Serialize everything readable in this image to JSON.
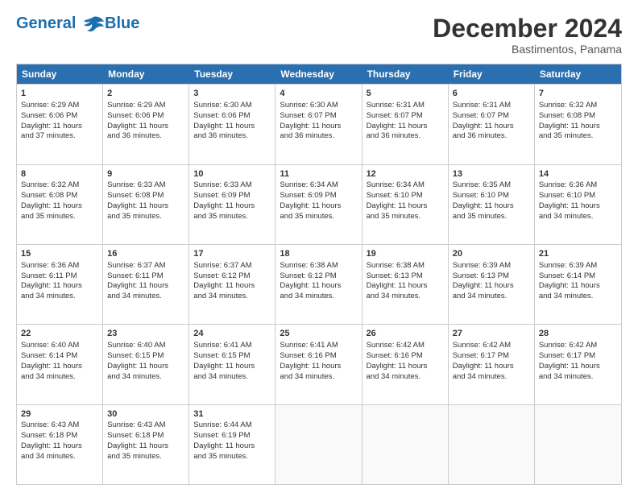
{
  "logo": {
    "line1": "General",
    "line2": "Blue"
  },
  "title": "December 2024",
  "subtitle": "Bastimentos, Panama",
  "days_of_week": [
    "Sunday",
    "Monday",
    "Tuesday",
    "Wednesday",
    "Thursday",
    "Friday",
    "Saturday"
  ],
  "weeks": [
    [
      {
        "day": "1",
        "info": "Sunrise: 6:29 AM\nSunset: 6:06 PM\nDaylight: 11 hours\nand 37 minutes."
      },
      {
        "day": "2",
        "info": "Sunrise: 6:29 AM\nSunset: 6:06 PM\nDaylight: 11 hours\nand 36 minutes."
      },
      {
        "day": "3",
        "info": "Sunrise: 6:30 AM\nSunset: 6:06 PM\nDaylight: 11 hours\nand 36 minutes."
      },
      {
        "day": "4",
        "info": "Sunrise: 6:30 AM\nSunset: 6:07 PM\nDaylight: 11 hours\nand 36 minutes."
      },
      {
        "day": "5",
        "info": "Sunrise: 6:31 AM\nSunset: 6:07 PM\nDaylight: 11 hours\nand 36 minutes."
      },
      {
        "day": "6",
        "info": "Sunrise: 6:31 AM\nSunset: 6:07 PM\nDaylight: 11 hours\nand 36 minutes."
      },
      {
        "day": "7",
        "info": "Sunrise: 6:32 AM\nSunset: 6:08 PM\nDaylight: 11 hours\nand 35 minutes."
      }
    ],
    [
      {
        "day": "8",
        "info": "Sunrise: 6:32 AM\nSunset: 6:08 PM\nDaylight: 11 hours\nand 35 minutes."
      },
      {
        "day": "9",
        "info": "Sunrise: 6:33 AM\nSunset: 6:08 PM\nDaylight: 11 hours\nand 35 minutes."
      },
      {
        "day": "10",
        "info": "Sunrise: 6:33 AM\nSunset: 6:09 PM\nDaylight: 11 hours\nand 35 minutes."
      },
      {
        "day": "11",
        "info": "Sunrise: 6:34 AM\nSunset: 6:09 PM\nDaylight: 11 hours\nand 35 minutes."
      },
      {
        "day": "12",
        "info": "Sunrise: 6:34 AM\nSunset: 6:10 PM\nDaylight: 11 hours\nand 35 minutes."
      },
      {
        "day": "13",
        "info": "Sunrise: 6:35 AM\nSunset: 6:10 PM\nDaylight: 11 hours\nand 35 minutes."
      },
      {
        "day": "14",
        "info": "Sunrise: 6:36 AM\nSunset: 6:10 PM\nDaylight: 11 hours\nand 34 minutes."
      }
    ],
    [
      {
        "day": "15",
        "info": "Sunrise: 6:36 AM\nSunset: 6:11 PM\nDaylight: 11 hours\nand 34 minutes."
      },
      {
        "day": "16",
        "info": "Sunrise: 6:37 AM\nSunset: 6:11 PM\nDaylight: 11 hours\nand 34 minutes."
      },
      {
        "day": "17",
        "info": "Sunrise: 6:37 AM\nSunset: 6:12 PM\nDaylight: 11 hours\nand 34 minutes."
      },
      {
        "day": "18",
        "info": "Sunrise: 6:38 AM\nSunset: 6:12 PM\nDaylight: 11 hours\nand 34 minutes."
      },
      {
        "day": "19",
        "info": "Sunrise: 6:38 AM\nSunset: 6:13 PM\nDaylight: 11 hours\nand 34 minutes."
      },
      {
        "day": "20",
        "info": "Sunrise: 6:39 AM\nSunset: 6:13 PM\nDaylight: 11 hours\nand 34 minutes."
      },
      {
        "day": "21",
        "info": "Sunrise: 6:39 AM\nSunset: 6:14 PM\nDaylight: 11 hours\nand 34 minutes."
      }
    ],
    [
      {
        "day": "22",
        "info": "Sunrise: 6:40 AM\nSunset: 6:14 PM\nDaylight: 11 hours\nand 34 minutes."
      },
      {
        "day": "23",
        "info": "Sunrise: 6:40 AM\nSunset: 6:15 PM\nDaylight: 11 hours\nand 34 minutes."
      },
      {
        "day": "24",
        "info": "Sunrise: 6:41 AM\nSunset: 6:15 PM\nDaylight: 11 hours\nand 34 minutes."
      },
      {
        "day": "25",
        "info": "Sunrise: 6:41 AM\nSunset: 6:16 PM\nDaylight: 11 hours\nand 34 minutes."
      },
      {
        "day": "26",
        "info": "Sunrise: 6:42 AM\nSunset: 6:16 PM\nDaylight: 11 hours\nand 34 minutes."
      },
      {
        "day": "27",
        "info": "Sunrise: 6:42 AM\nSunset: 6:17 PM\nDaylight: 11 hours\nand 34 minutes."
      },
      {
        "day": "28",
        "info": "Sunrise: 6:42 AM\nSunset: 6:17 PM\nDaylight: 11 hours\nand 34 minutes."
      }
    ],
    [
      {
        "day": "29",
        "info": "Sunrise: 6:43 AM\nSunset: 6:18 PM\nDaylight: 11 hours\nand 34 minutes."
      },
      {
        "day": "30",
        "info": "Sunrise: 6:43 AM\nSunset: 6:18 PM\nDaylight: 11 hours\nand 35 minutes."
      },
      {
        "day": "31",
        "info": "Sunrise: 6:44 AM\nSunset: 6:19 PM\nDaylight: 11 hours\nand 35 minutes."
      },
      {
        "day": "",
        "info": ""
      },
      {
        "day": "",
        "info": ""
      },
      {
        "day": "",
        "info": ""
      },
      {
        "day": "",
        "info": ""
      }
    ]
  ]
}
